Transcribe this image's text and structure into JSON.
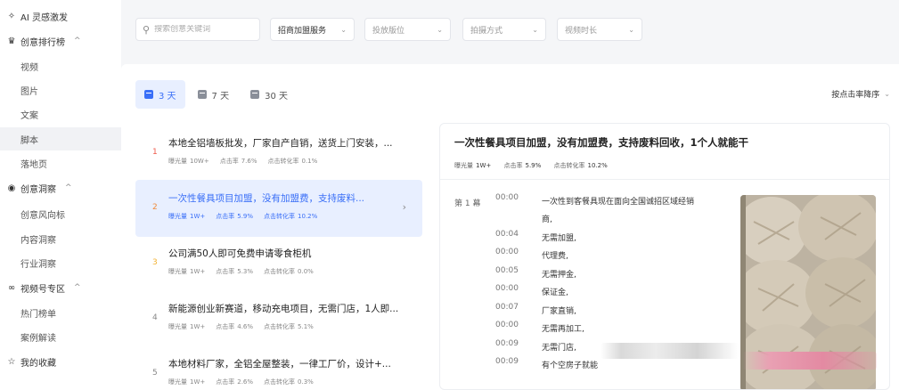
{
  "sidebar": {
    "items": [
      {
        "label": "AI 灵感激发",
        "icon": "sparkle-icon",
        "type": "group",
        "caret": ""
      },
      {
        "label": "创意排行榜",
        "icon": "trophy-icon",
        "type": "group",
        "caret": "^"
      },
      {
        "label": "视频",
        "type": "sub"
      },
      {
        "label": "图片",
        "type": "sub"
      },
      {
        "label": "文案",
        "type": "sub"
      },
      {
        "label": "脚本",
        "type": "sub",
        "active": true
      },
      {
        "label": "落地页",
        "type": "sub"
      },
      {
        "label": "创意洞察",
        "icon": "insight-icon",
        "type": "group",
        "caret": "^"
      },
      {
        "label": "创意风向标",
        "type": "sub"
      },
      {
        "label": "内容洞察",
        "type": "sub"
      },
      {
        "label": "行业洞察",
        "type": "sub"
      },
      {
        "label": "视频号专区",
        "icon": "channels-icon",
        "type": "group",
        "caret": "^"
      },
      {
        "label": "热门榜单",
        "type": "sub"
      },
      {
        "label": "案例解读",
        "type": "sub"
      },
      {
        "label": "我的收藏",
        "icon": "star-icon",
        "type": "group",
        "caret": ""
      }
    ]
  },
  "filters": {
    "search_placeholder": "搜索创意关键词",
    "dropdowns": [
      {
        "label": "招商加盟服务",
        "filled": true
      },
      {
        "label": "投放版位",
        "filled": false
      },
      {
        "label": "拍摄方式",
        "filled": false
      },
      {
        "label": "视频时长",
        "filled": false
      }
    ]
  },
  "period_tabs": [
    {
      "label": "3 天",
      "active": true
    },
    {
      "label": "7 天",
      "active": false
    },
    {
      "label": "30 天",
      "active": false
    }
  ],
  "sort_label": "按点击率降序",
  "stat_labels": {
    "exposure": "曝光量",
    "ctr": "点击率",
    "cvr": "点击转化率"
  },
  "ranking": [
    {
      "rank": "1",
      "title": "本地全铝墙板批发，厂家自产自销，送货上门安装，...",
      "exposure": "10W+",
      "ctr": "7.6%",
      "cvr": "0.1%"
    },
    {
      "rank": "2",
      "title": "一次性餐具项目加盟，没有加盟费，支持废料...",
      "exposure": "1W+",
      "ctr": "5.9%",
      "cvr": "10.2%",
      "selected": true
    },
    {
      "rank": "3",
      "title": "公司满50人即可免费申请零食柜机",
      "exposure": "1W+",
      "ctr": "5.3%",
      "cvr": "0.0%"
    },
    {
      "rank": "4",
      "title": "新能源创业新赛道，移动充电项目，无需门店，1人即...",
      "exposure": "1W+",
      "ctr": "4.6%",
      "cvr": "5.1%"
    },
    {
      "rank": "5",
      "title": "本地材料厂家，全铝全屋整装，一律工厂价，设计+...",
      "exposure": "1W+",
      "ctr": "2.6%",
      "cvr": "0.3%"
    }
  ],
  "detail": {
    "title": "一次性餐具项目加盟，没有加盟费，支持废料回收，1个人就能干",
    "exposure": "1W+",
    "ctr": "5.9%",
    "cvr": "10.2%",
    "scene_label": "第 1 幕",
    "subtitles": [
      {
        "time": "00:00",
        "text": "一次性到客餐具现在面向全国诚招区域经销"
      },
      {
        "time": "",
        "text": "商,"
      },
      {
        "time": "00:04",
        "text": "无需加盟,"
      },
      {
        "time": "00:00",
        "text": "代理费,"
      },
      {
        "time": "00:05",
        "text": "无需押金,"
      },
      {
        "time": "00:00",
        "text": "保证金,"
      },
      {
        "time": "00:07",
        "text": "厂家直销,"
      },
      {
        "time": "00:00",
        "text": "无需再加工,"
      },
      {
        "time": "00:09",
        "text": "无需门店,"
      },
      {
        "time": "00:09",
        "text": "有个空房子就能"
      }
    ]
  }
}
